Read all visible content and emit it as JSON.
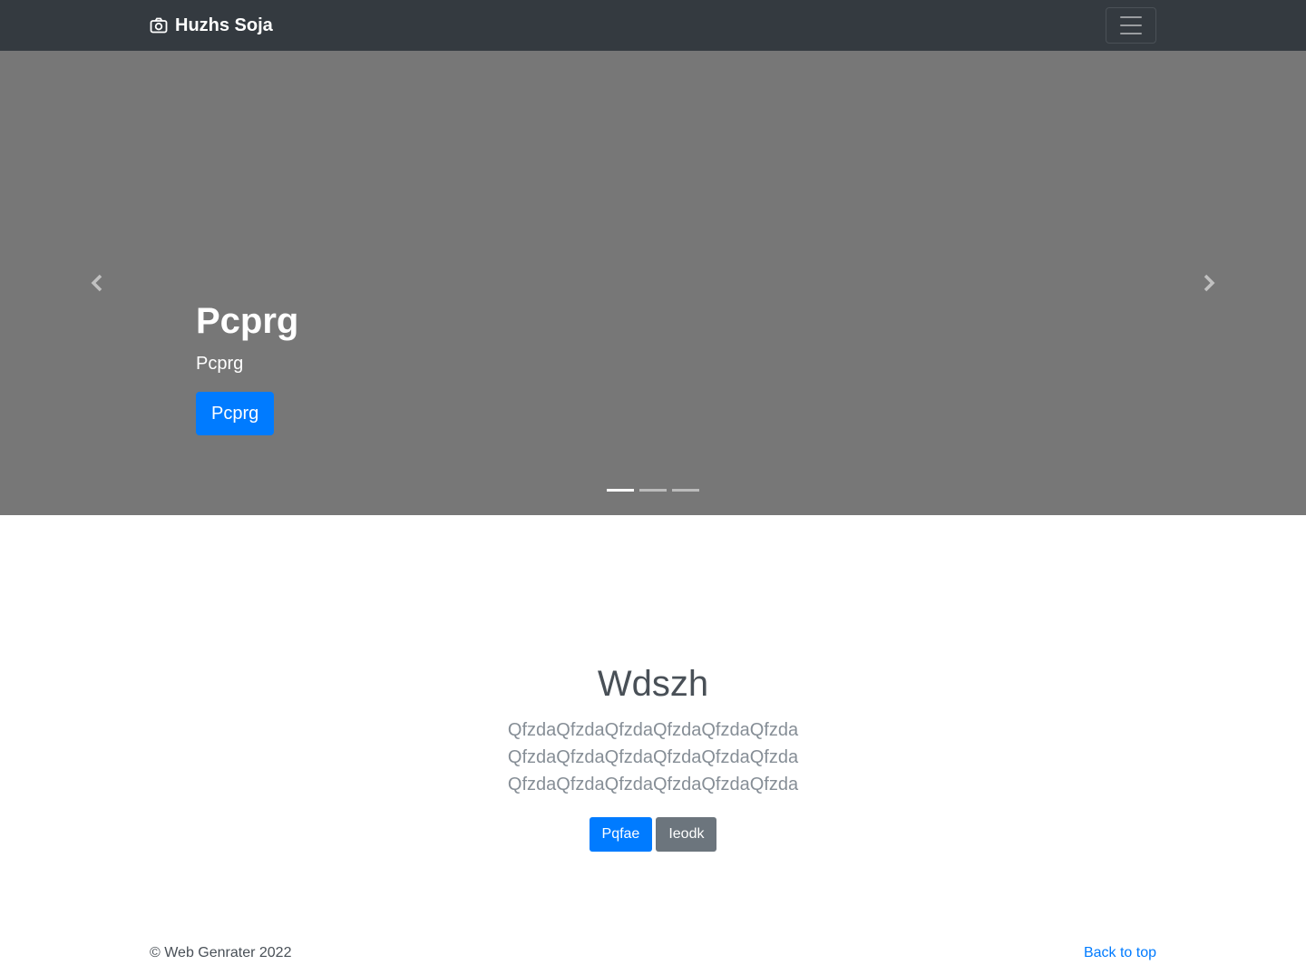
{
  "navbar": {
    "brand_icon": "camera-icon",
    "brand": "Huzhs Soja",
    "toggler_icon": "hamburger-icon"
  },
  "carousel": {
    "slide": {
      "heading": "Pcprg",
      "text": "Pcprg",
      "button": "Pcprg"
    },
    "indicators": 3,
    "active_indicator": 0,
    "prev_icon": "chevron-left-icon",
    "next_icon": "chevron-right-icon"
  },
  "jumbotron": {
    "heading": "Wdszh",
    "lines": [
      "QfzdaQfzdaQfzdaQfzdaQfzdaQfzda",
      "QfzdaQfzdaQfzdaQfzdaQfzdaQfzda",
      "QfzdaQfzdaQfzdaQfzdaQfzdaQfzda"
    ],
    "primary_button": "Pqfae",
    "secondary_button": "Ieodk"
  },
  "footer": {
    "copyright": "© Web Genrater 2022",
    "back_to_top": "Back to top"
  },
  "colors": {
    "navbar_bg": "#343a40",
    "carousel_bg": "#777777",
    "primary": "#007bff",
    "secondary": "#6c757d"
  }
}
